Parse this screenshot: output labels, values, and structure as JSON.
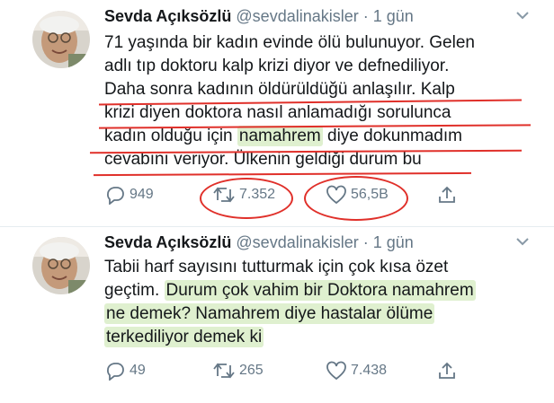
{
  "tweets": [
    {
      "name": "Sevda Açıksözlü",
      "handle": "@sevdalinakisler",
      "dot": "·",
      "time": "1 gün",
      "lines": [
        "71 yaşında bir kadın evinde ölü bulunuyor. Gelen",
        "adlı tıp  doktoru kalp krizi diyor ve defnediliyor.",
        "Daha sonra kadının öldürüldüğü anlaşılır. Kalp",
        "krizi diyen doktora nasıl anlamadığı sorulunca",
        "kadın olduğu için ",
        "namahrem",
        " diye dokunmadım",
        "cevabını veriyor. Ülkenin geldiği durum bu"
      ],
      "replies": "949",
      "retweets": "7.352",
      "likes": "56,5B"
    },
    {
      "name": "Sevda Açıksözlü",
      "handle": "@sevdalinakisler",
      "dot": "·",
      "time": "1 gün",
      "lines": [
        "Tabii harf sayısını tutturmak için çok kısa özet",
        "geçtim. ",
        "Durum çok vahim bir Doktora namahrem",
        "ne demek? Namahrem diye hastalar ölüme",
        "terkediliyor demek ki"
      ],
      "replies": "49",
      "retweets": "265",
      "likes": "7.438"
    }
  ],
  "colors": {
    "annotation_red": "#e0302a",
    "highlight_green": "#dff0cf",
    "meta_gray": "#657786"
  }
}
